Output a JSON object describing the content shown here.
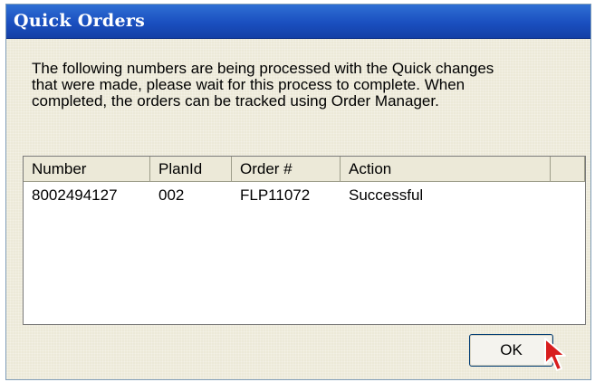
{
  "dialog": {
    "title": "Quick Orders",
    "message": "The following numbers are being processed with the Quick changes\nthat were made, please wait for this process to complete.  When\ncompleted, the orders can be tracked using Order Manager."
  },
  "table": {
    "columns": [
      "Number",
      "PlanId",
      "Order #",
      "Action",
      ""
    ],
    "rows": [
      [
        "8002494127",
        "002",
        "FLP11072",
        "Successful"
      ]
    ]
  },
  "buttons": {
    "ok_label": "OK"
  },
  "colors": {
    "titlebar": "#1a4fbf",
    "dialog_bg": "#ece9d8"
  },
  "icons": {
    "pointer": "mouse-cursor-icon"
  }
}
